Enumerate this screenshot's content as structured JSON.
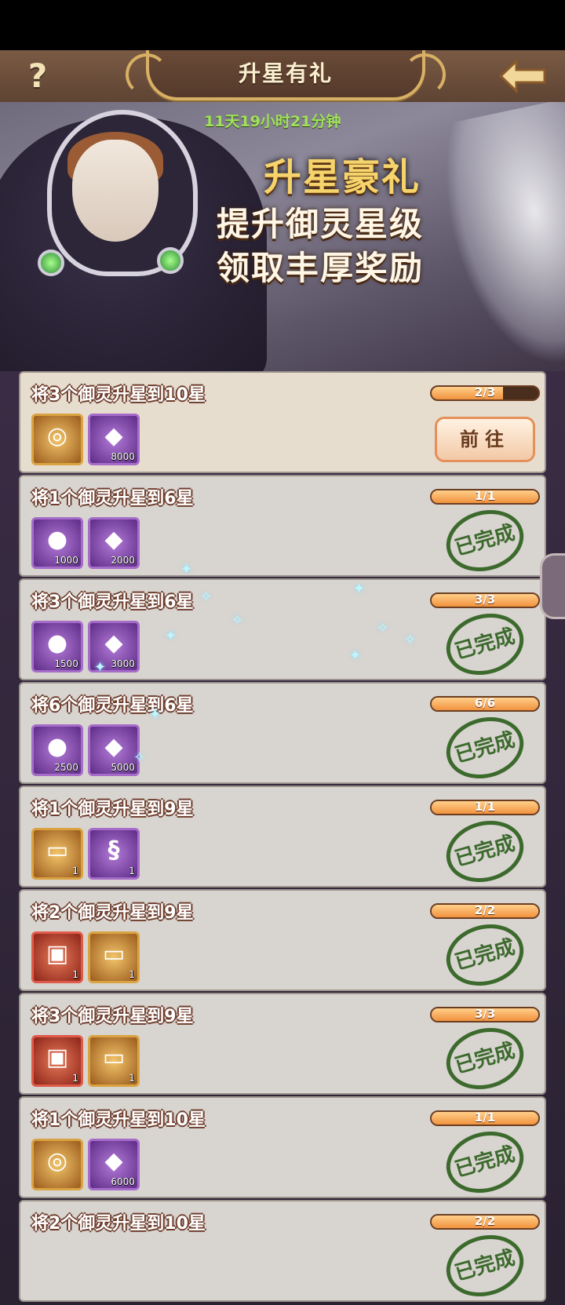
{
  "header": {
    "title": "升星有礼",
    "help_label": "?"
  },
  "banner": {
    "timer": "11天19小时21分钟",
    "headline": "升星豪礼",
    "line1": "提升御灵星级",
    "line2": "领取丰厚奖励"
  },
  "tasks": [
    {
      "title": "将3个御灵升星到10星",
      "progress_text": "2/3",
      "progress": 0.667,
      "state": "goto",
      "button": "前往",
      "rewards": [
        {
          "icon": "gold-medal-icon",
          "qty": "",
          "style": "gold",
          "glyph": "◎"
        },
        {
          "icon": "red-gem-icon",
          "qty": "8000",
          "style": "purple",
          "glyph": "◆"
        }
      ]
    },
    {
      "title": "将1个御灵升星到6星",
      "progress_text": "1/1",
      "progress": 1,
      "state": "done",
      "stamp": "已完成",
      "rewards": [
        {
          "icon": "blue-orb-icon",
          "qty": "1000",
          "style": "purple",
          "glyph": "●"
        },
        {
          "icon": "red-gem-icon",
          "qty": "2000",
          "style": "purple",
          "glyph": "◆"
        }
      ]
    },
    {
      "title": "将3个御灵升星到6星",
      "progress_text": "3/3",
      "progress": 1,
      "state": "done",
      "stamp": "已完成",
      "rewards": [
        {
          "icon": "blue-orb-icon",
          "qty": "1500",
          "style": "purple",
          "glyph": "●"
        },
        {
          "icon": "red-gem-icon",
          "qty": "3000",
          "style": "purple",
          "glyph": "◆"
        }
      ]
    },
    {
      "title": "将6个御灵升星到6星",
      "progress_text": "6/6",
      "progress": 1,
      "state": "done",
      "stamp": "已完成",
      "rewards": [
        {
          "icon": "blue-orb-icon",
          "qty": "2500",
          "style": "purple",
          "glyph": "●"
        },
        {
          "icon": "red-gem-icon",
          "qty": "5000",
          "style": "purple",
          "glyph": "◆"
        }
      ]
    },
    {
      "title": "将1个御灵升星到9星",
      "progress_text": "1/1",
      "progress": 1,
      "state": "done",
      "stamp": "已完成",
      "rewards": [
        {
          "icon": "ticket-icon",
          "qty": "1",
          "style": "gold",
          "glyph": "▭"
        },
        {
          "icon": "scroll-icon",
          "qty": "1",
          "style": "purple",
          "glyph": "§"
        }
      ]
    },
    {
      "title": "将2个御灵升星到9星",
      "progress_text": "2/2",
      "progress": 1,
      "state": "done",
      "stamp": "已完成",
      "rewards": [
        {
          "icon": "treasure-chest-icon",
          "qty": "1",
          "style": "red",
          "glyph": "▣"
        },
        {
          "icon": "ticket-icon",
          "qty": "1",
          "style": "gold",
          "glyph": "▭"
        }
      ]
    },
    {
      "title": "将3个御灵升星到9星",
      "progress_text": "3/3",
      "progress": 1,
      "state": "done",
      "stamp": "已完成",
      "rewards": [
        {
          "icon": "treasure-chest-icon",
          "qty": "1",
          "style": "red",
          "glyph": "▣"
        },
        {
          "icon": "ticket-icon",
          "qty": "1",
          "style": "gold",
          "glyph": "▭"
        }
      ]
    },
    {
      "title": "将1个御灵升星到10星",
      "progress_text": "1/1",
      "progress": 1,
      "state": "done",
      "stamp": "已完成",
      "rewards": [
        {
          "icon": "gold-medal-icon",
          "qty": "",
          "style": "gold",
          "glyph": "◎"
        },
        {
          "icon": "red-gem-icon",
          "qty": "6000",
          "style": "purple",
          "glyph": "◆"
        }
      ]
    },
    {
      "title": "将2个御灵升星到10星",
      "progress_text": "2/2",
      "progress": 1,
      "state": "done",
      "stamp": "已完成",
      "rewards": []
    }
  ]
}
